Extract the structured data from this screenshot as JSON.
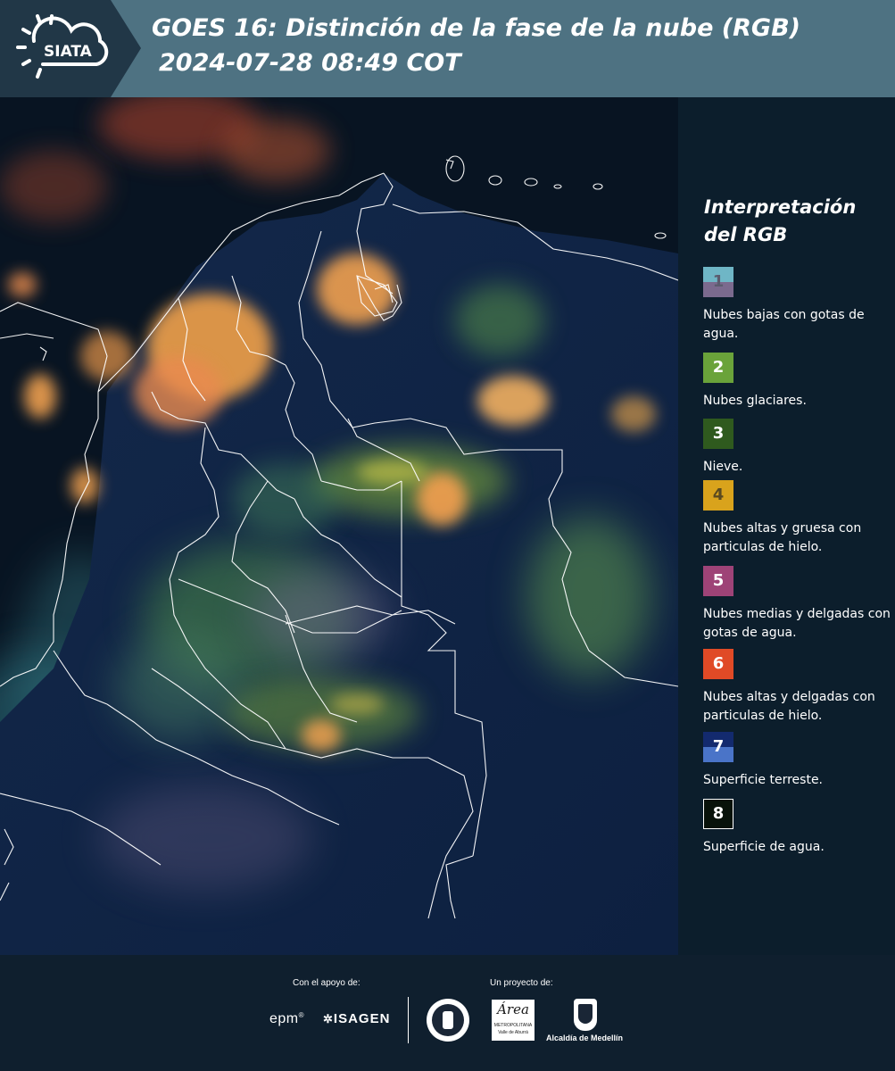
{
  "header": {
    "logo_text": "SIATA",
    "title_line1": "GOES 16: Distinción de la fase de la nube (RGB)",
    "title_line2": "2024-07-28 08:49 COT"
  },
  "legend": {
    "title_line1": "Interpretación",
    "title_line2": "del RGB",
    "items": [
      {
        "number": "1",
        "label": "Nubes bajas con gotas de agua.",
        "color_top": "#6fb6c6",
        "color_bottom": "#7b6a8e"
      },
      {
        "number": "2",
        "label": "Nubes glaciares.",
        "color_top": "#6aa33a",
        "color_bottom": "#6aa33a"
      },
      {
        "number": "3",
        "label": "Nieve.",
        "color_top": "#2f5a1e",
        "color_bottom": "#2f5a1e"
      },
      {
        "number": "4",
        "label": "Nubes altas y gruesa con particulas de hielo.",
        "color_top": "#d9a31c",
        "color_bottom": "#d9a31c"
      },
      {
        "number": "5",
        "label": "Nubes medias y delgadas con gotas de agua.",
        "color_top": "#9e4377",
        "color_bottom": "#9e4377"
      },
      {
        "number": "6",
        "label": "Nubes altas y delgadas con particulas de hielo.",
        "color_top": "#e04a26",
        "color_bottom": "#e04a26"
      },
      {
        "number": "7",
        "label": "Superficie terreste.",
        "color_top": "#132a6e",
        "color_bottom": "#4a74c8"
      },
      {
        "number": "8",
        "label": "Superficie de agua.",
        "color_top": "#08120a",
        "color_bottom": "#08120a"
      }
    ]
  },
  "footer": {
    "support_label": "Con el apoyo de:",
    "project_label": "Un proyecto de:",
    "epm_text": "epm",
    "isagen_text": "ISAGEN",
    "area_text": "Área",
    "area_sub1": "METROPOLITANA",
    "area_sub2": "Valle de Aburrá",
    "alcaldia_text": "Alcaldía de Medellín"
  }
}
